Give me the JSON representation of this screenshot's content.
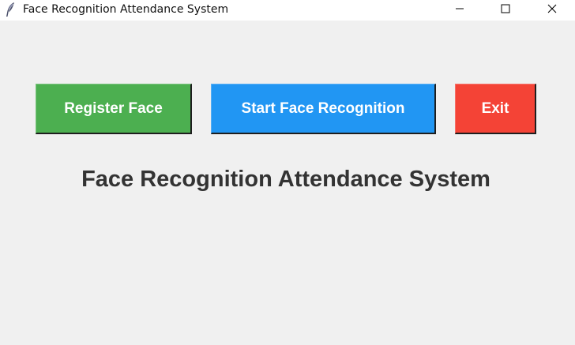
{
  "window": {
    "title": "Face Recognition Attendance System",
    "icon": "feather-icon",
    "controls": {
      "minimize_icon": "minimize-icon",
      "maximize_icon": "maximize-icon",
      "close_icon": "close-icon"
    }
  },
  "buttons": {
    "register": {
      "label": "Register Face",
      "color": "#4caf50"
    },
    "start": {
      "label": "Start Face Recognition",
      "color": "#2196f3"
    },
    "exit": {
      "label": "Exit",
      "color": "#f44336"
    }
  },
  "heading": "Face Recognition Attendance System",
  "colors": {
    "background": "#f0f0f0",
    "titlebar": "#ffffff",
    "heading_text": "#333333"
  }
}
